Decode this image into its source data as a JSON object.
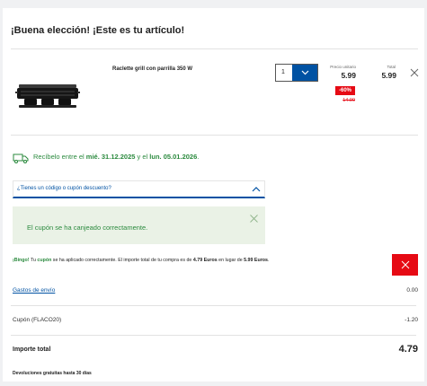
{
  "header": {
    "title": "¡Buena elección! ¡Este es tu artículo!"
  },
  "product": {
    "name": "Raclette grill con parrilla 350 W",
    "quantity": "1",
    "unit_price_label": "Precio unitario",
    "unit_price": "5.99",
    "discount_badge": "-60%",
    "old_price": "14.99",
    "total_label": "Total",
    "total_price": "5.99",
    "image_icon": "raclette-grill-image"
  },
  "delivery": {
    "prefix": "Recíbelo entre el",
    "date_from": "mié. 31.12.2025",
    "connector": "y el",
    "date_to": "lun. 05.01.2026",
    "suffix": "."
  },
  "coupon": {
    "question": "¿Tienes un código o cupón descuento?",
    "success_message": "El cupón se ha canjeado correctamente."
  },
  "bingo": {
    "bingo": "¡Bingo!",
    "p1": "Tu",
    "cupon": "cupón",
    "p2": "se ha aplicado correctamente. El importe total de tu compra es de",
    "new_amount": "4.79 Euros",
    "p3": "en lugar de",
    "old_amount": "5.99 Euros",
    "p4": "."
  },
  "summary": {
    "shipping_label": "Gastos de envío",
    "shipping_value": "0.00",
    "coupon_label": "Cupón (FLACO20)",
    "coupon_value": "-1.20",
    "total_label": "Importe total",
    "total_value": "4.79",
    "returns_note": "Devoluciones gratuitas hasta 30 días"
  },
  "colors": {
    "accent_blue": "#0052a3",
    "sale_red": "#e60a14",
    "success_green": "#2b8a3e",
    "success_bg": "#eaf2e6"
  }
}
